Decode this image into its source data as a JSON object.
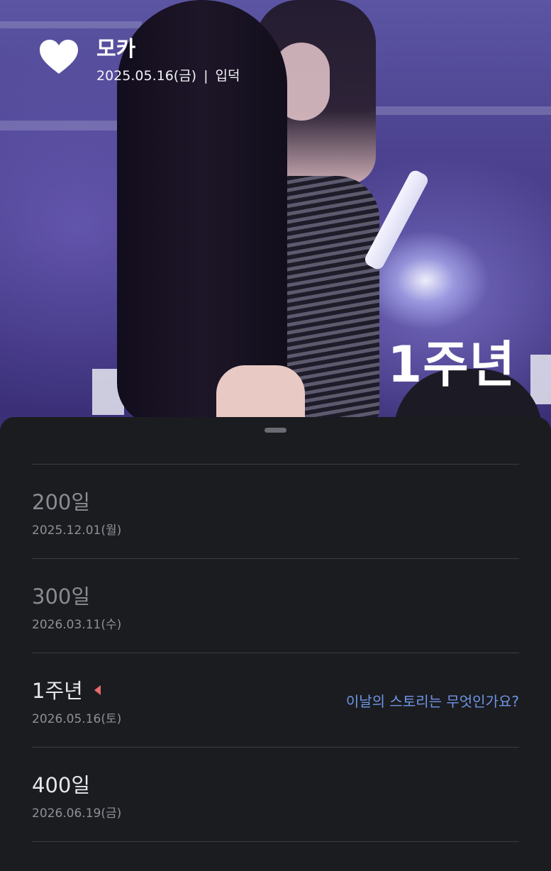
{
  "header": {
    "title": "모카",
    "date": "2025.05.16(금)",
    "separator": "|",
    "tag": "입덕",
    "milestone_badge": "1주년"
  },
  "milestones": [
    {
      "label": "200일",
      "date": "2025.12.01(월)",
      "state": "past"
    },
    {
      "label": "300일",
      "date": "2026.03.11(수)",
      "state": "past"
    },
    {
      "label": "1주년",
      "date": "2026.05.16(토)",
      "state": "current",
      "action": "이날의 스토리는 무엇인가요?"
    },
    {
      "label": "400일",
      "date": "2026.06.19(금)",
      "state": "upcoming"
    }
  ],
  "colors": {
    "sheet_bg": "#1b1c20",
    "link": "#6f95e6",
    "indicator": "#e86a6a",
    "dim_text": "#8a8c93"
  }
}
